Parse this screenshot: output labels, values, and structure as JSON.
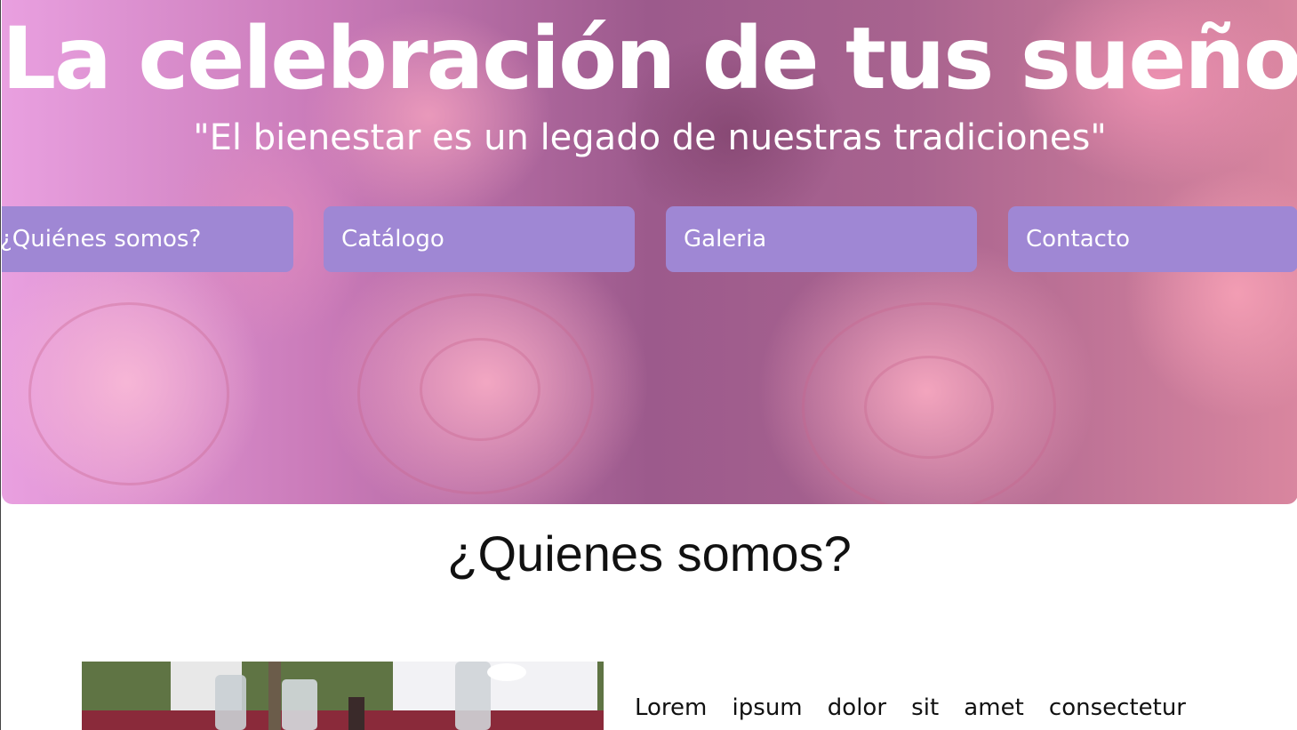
{
  "hero": {
    "title": "La celebración de tus sueños",
    "subtitle": "\"El bienestar es un legado de nuestras tradiciones\""
  },
  "nav": {
    "items": [
      {
        "label": "¿Quiénes somos?"
      },
      {
        "label": "Catálogo"
      },
      {
        "label": "Galeria"
      },
      {
        "label": "Contacto"
      }
    ]
  },
  "about": {
    "title": "¿Quienes somos?",
    "body": "Lorem ipsum dolor sit amet consectetur"
  },
  "colors": {
    "nav_button": "#9f87d4",
    "hero_text": "#ffffff",
    "body_text": "#111111"
  }
}
